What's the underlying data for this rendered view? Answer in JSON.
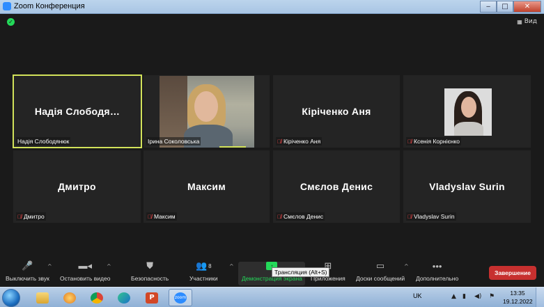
{
  "window": {
    "title": "Zoom Конференция"
  },
  "meeting": {
    "view_label": "Вид",
    "tiles": [
      {
        "big_name": "Надія Слободя…",
        "label": "Надія Слободянюк",
        "muted": false,
        "active": true,
        "video": false
      },
      {
        "big_name": "",
        "label": "Ірина Соколовська",
        "muted": false,
        "active": false,
        "video": true
      },
      {
        "big_name": "Кіріченко Аня",
        "label": "Кіріченко Аня",
        "muted": true,
        "active": false,
        "video": false
      },
      {
        "big_name": "",
        "label": "Ксенія Корнієнко",
        "muted": true,
        "active": false,
        "video": true
      },
      {
        "big_name": "Дмитро",
        "label": "Дмитро",
        "muted": true,
        "active": false,
        "video": false
      },
      {
        "big_name": "Максим",
        "label": "Максим",
        "muted": true,
        "active": false,
        "video": false
      },
      {
        "big_name": "Смєлов Денис",
        "label": "Смєлов Денис",
        "muted": true,
        "active": false,
        "video": false
      },
      {
        "big_name": "Vladyslav Surin",
        "label": "Vladyslav Surin",
        "muted": true,
        "active": false,
        "video": false
      }
    ]
  },
  "toolbar": {
    "mute": "Выключить звук",
    "video": "Остановить видео",
    "security": "Безопасность",
    "participants": "Участники",
    "participants_count": "8",
    "share": "Демонстрация экрана",
    "share_tooltip": "Трансляция (Alt+S)",
    "apps": "Приложения",
    "whiteboards": "Доски сообщений",
    "more": "Дополнительно",
    "end": "Завершение"
  },
  "taskbar": {
    "zoom_icon_label": "zoom",
    "language": "UK",
    "time": "13:35",
    "date": "19.12.2022"
  },
  "colors": {
    "active_speaker": "#d2e25a",
    "share_green": "#23d959",
    "end_red": "#c7302f",
    "muted_red": "#ff4b4b"
  }
}
